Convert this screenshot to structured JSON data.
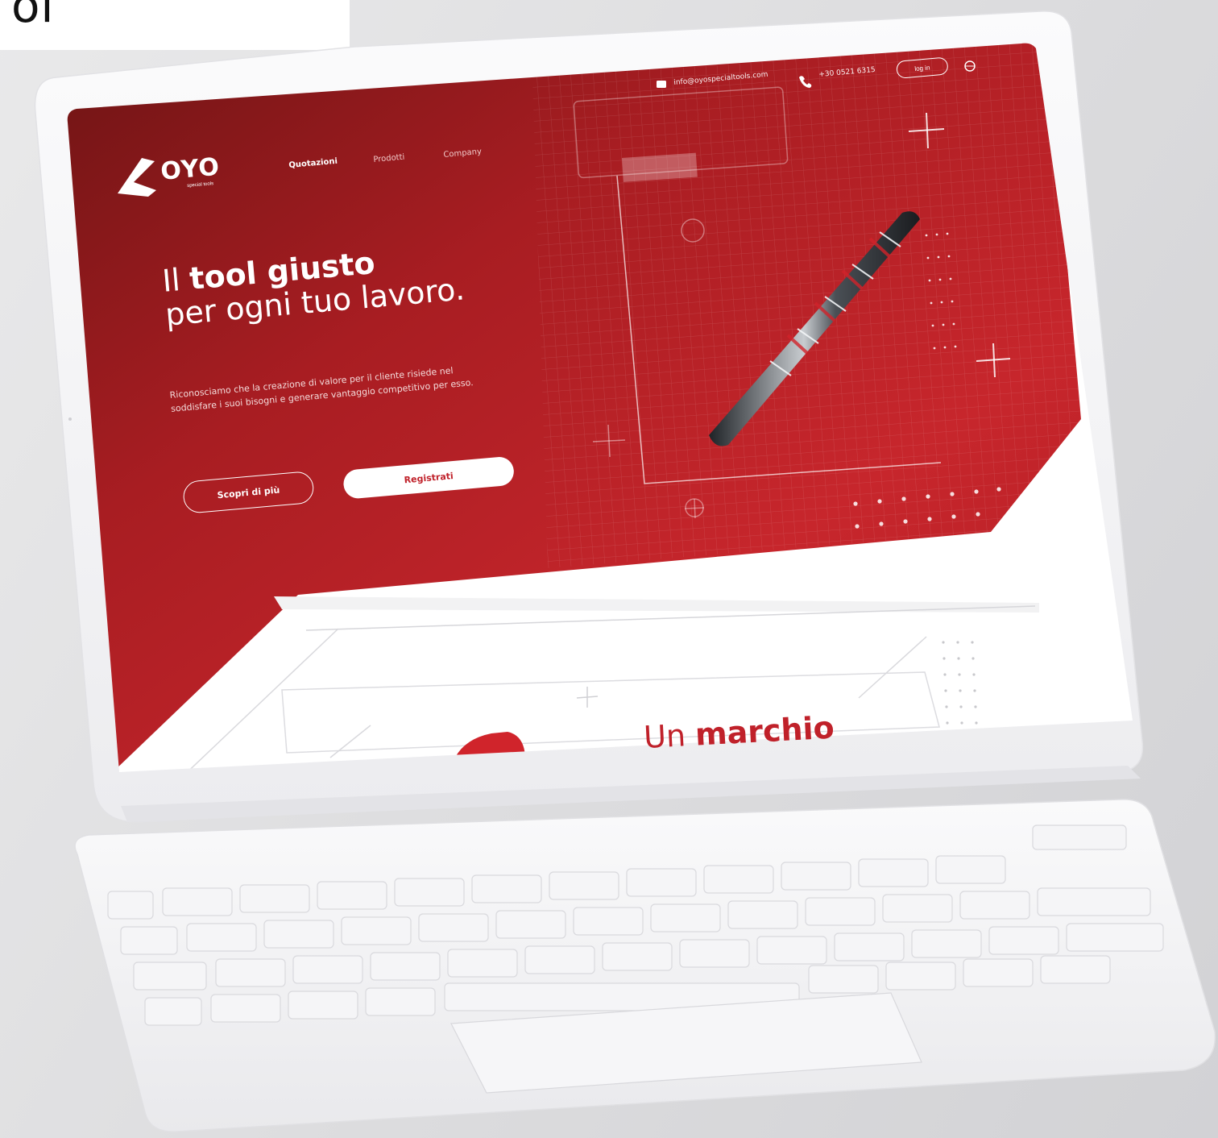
{
  "corner_text": "of",
  "topbar": {
    "email": "info@oyospecialtools.com",
    "phone": "+30 0521 6315",
    "login_label": "log in"
  },
  "logo": {
    "name": "OYO",
    "subtitle": "special tools"
  },
  "nav": {
    "items": [
      "Quotazioni",
      "Prodotti",
      "Company"
    ]
  },
  "hero": {
    "title_prefix": "Il ",
    "title_bold": "tool giusto",
    "title_line2": "per ogni tuo lavoro.",
    "description": "Riconosciamo che la creazione di valore per il cliente risiede nel soddisfare i suoi bisogni e generare vantaggio competitivo per esso.",
    "btn_secondary": "Scopri di più",
    "btn_primary": "Registrati"
  },
  "section2": {
    "title_prefix": "Un ",
    "title_bold": "marchio"
  },
  "colors": {
    "brand_red": "#c0212a",
    "deep_red": "#7e1818",
    "device_white": "#f7f7f8"
  }
}
